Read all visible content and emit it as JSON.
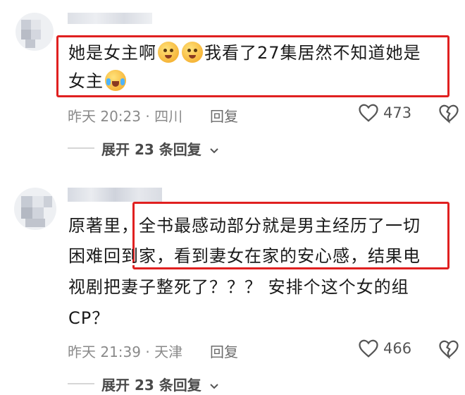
{
  "comments": [
    {
      "text_line1": "她是女主啊",
      "text_line1b": "我看了27集居然不知道她是",
      "text_line2": "女主",
      "meta": "昨天 20:23 · 四川",
      "reply_label": "回复",
      "likes": "473",
      "expand_label": "展开 23 条回复"
    },
    {
      "prefix": "原著里，",
      "text_line1": "全书最感动部分就是男主经历了一切",
      "text_line2": "困难回到家，看到妻女在家的安心感，结果电",
      "text_line3": "视剧把妻子整死了？？？ 安排个这个女的组",
      "text_line4": "CP？",
      "meta": "昨天 21:39 · 天津",
      "reply_label": "回复",
      "likes": "466",
      "expand_label": "展开 23 条回复"
    }
  ],
  "icons": {
    "like": "heart-outline-icon",
    "dislike": "broken-heart-icon",
    "expand": "chevron-down-icon",
    "emoji_1": "pleading-face-emoji",
    "emoji_2": "loudly-crying-face-emoji"
  },
  "colors": {
    "highlight_box": "#e02020",
    "meta_text": "#8a8a8a"
  }
}
